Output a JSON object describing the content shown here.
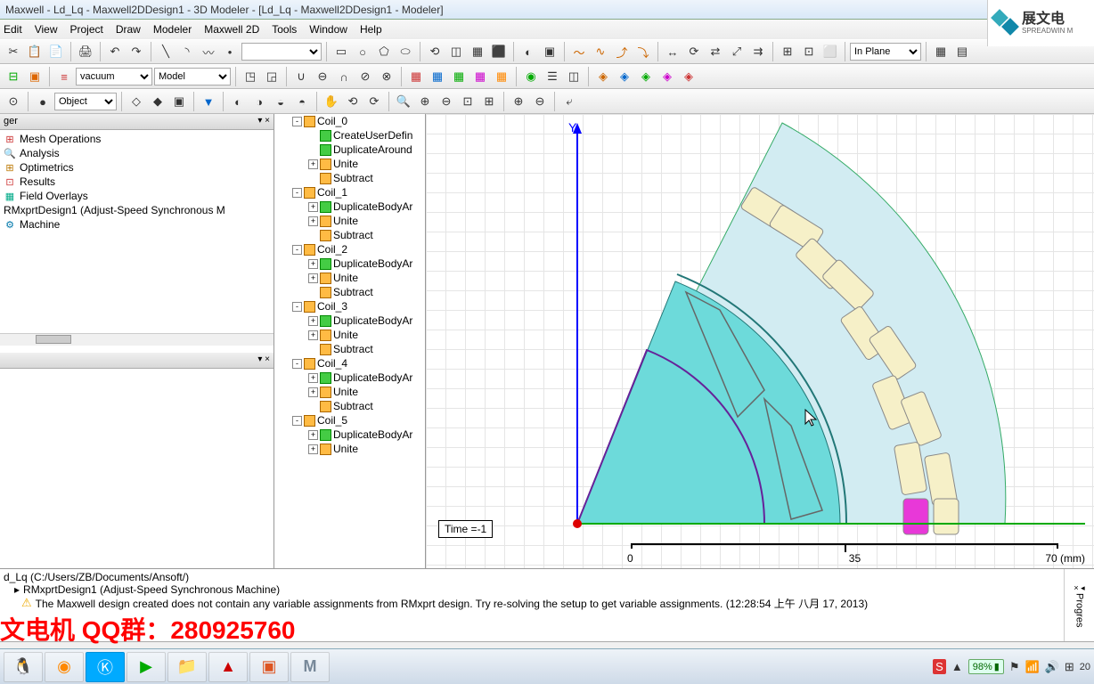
{
  "window": {
    "title": "Maxwell - Ld_Lq - Maxwell2DDesign1 - 3D Modeler - [Ld_Lq - Maxwell2DDesign1 - Modeler]"
  },
  "menu": {
    "items": [
      "Edit",
      "View",
      "Project",
      "Draw",
      "Modeler",
      "Maxwell 2D",
      "Tools",
      "Window",
      "Help"
    ]
  },
  "toolbar2": {
    "material": "vacuum",
    "mode": "Model"
  },
  "toolbar3": {
    "context": "Object"
  },
  "toolbar1": {
    "plane": "In Plane"
  },
  "left_panel": {
    "header": "ger",
    "items": [
      {
        "icon": "mesh",
        "label": "Mesh Operations"
      },
      {
        "icon": "analysis",
        "label": "Analysis"
      },
      {
        "icon": "opt",
        "label": "Optimetrics"
      },
      {
        "icon": "results",
        "label": "Results"
      },
      {
        "icon": "field",
        "label": "Field Overlays"
      }
    ],
    "design_line": "RMxprtDesign1 (Adjust-Speed Synchronous M",
    "machine": "Machine"
  },
  "model_tree": [
    {
      "level": 1,
      "exp": "-",
      "icon": "box",
      "label": "Coil_0"
    },
    {
      "level": 2,
      "exp": "",
      "icon": "op",
      "label": "CreateUserDefin"
    },
    {
      "level": 2,
      "exp": "",
      "icon": "op",
      "label": "DuplicateAround"
    },
    {
      "level": 2,
      "exp": "+",
      "icon": "box",
      "label": "Unite"
    },
    {
      "level": 2,
      "exp": "",
      "icon": "box",
      "label": "Subtract"
    },
    {
      "level": 1,
      "exp": "-",
      "icon": "box",
      "label": "Coil_1"
    },
    {
      "level": 2,
      "exp": "+",
      "icon": "op",
      "label": "DuplicateBodyAr"
    },
    {
      "level": 2,
      "exp": "+",
      "icon": "box",
      "label": "Unite"
    },
    {
      "level": 2,
      "exp": "",
      "icon": "box",
      "label": "Subtract"
    },
    {
      "level": 1,
      "exp": "-",
      "icon": "box",
      "label": "Coil_2"
    },
    {
      "level": 2,
      "exp": "+",
      "icon": "op",
      "label": "DuplicateBodyAr"
    },
    {
      "level": 2,
      "exp": "+",
      "icon": "box",
      "label": "Unite"
    },
    {
      "level": 2,
      "exp": "",
      "icon": "box",
      "label": "Subtract"
    },
    {
      "level": 1,
      "exp": "-",
      "icon": "box",
      "label": "Coil_3"
    },
    {
      "level": 2,
      "exp": "+",
      "icon": "op",
      "label": "DuplicateBodyAr"
    },
    {
      "level": 2,
      "exp": "+",
      "icon": "box",
      "label": "Unite"
    },
    {
      "level": 2,
      "exp": "",
      "icon": "box",
      "label": "Subtract"
    },
    {
      "level": 1,
      "exp": "-",
      "icon": "box",
      "label": "Coil_4"
    },
    {
      "level": 2,
      "exp": "+",
      "icon": "op",
      "label": "DuplicateBodyAr"
    },
    {
      "level": 2,
      "exp": "+",
      "icon": "box",
      "label": "Unite"
    },
    {
      "level": 2,
      "exp": "",
      "icon": "box",
      "label": "Subtract"
    },
    {
      "level": 1,
      "exp": "-",
      "icon": "box",
      "label": "Coil_5"
    },
    {
      "level": 2,
      "exp": "+",
      "icon": "op",
      "label": "DuplicateBodyAr"
    },
    {
      "level": 2,
      "exp": "+",
      "icon": "box",
      "label": "Unite"
    }
  ],
  "viewport": {
    "time_label": "Time =-1",
    "y_label": "Y",
    "ruler": {
      "ticks": [
        "0",
        "35",
        "70 (mm)"
      ]
    }
  },
  "messages": {
    "line1": "d_Lq (C:/Users/ZB/Documents/Ansoft/)",
    "line2": "RMxprtDesign1 (Adjust-Speed Synchronous Machine)",
    "line3": "The Maxwell design created does not contain any variable assignments from RMxprt design.   Try re-solving the setup to get variable assignments. (12:28:54 上午  八月 17, 2013)",
    "progress_label": "Progres"
  },
  "watermark": "文电机  QQ群：280925760",
  "logo": {
    "text": "展文电",
    "sub": "SPREADWIN M"
  },
  "tray": {
    "battery": "98%"
  }
}
